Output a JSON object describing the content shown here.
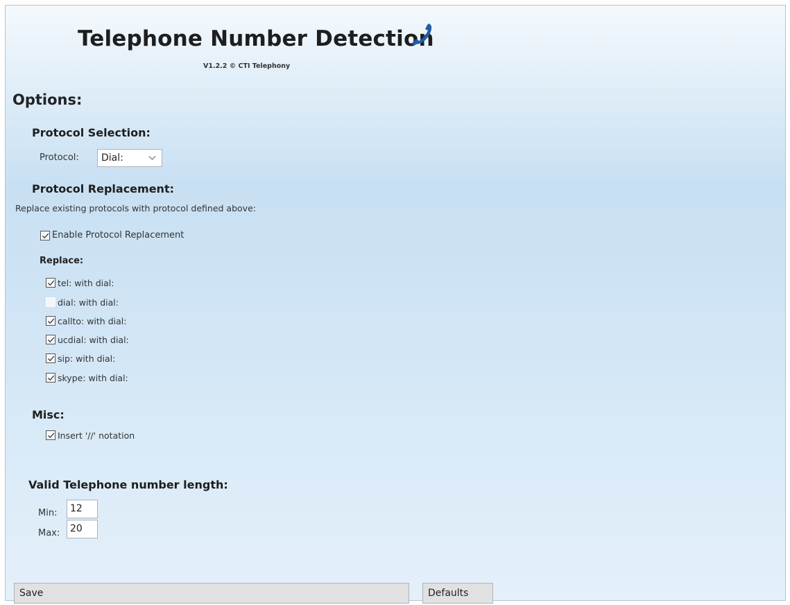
{
  "header": {
    "title": "Telephone Number Detection",
    "version": "V1.2.2 © CTI Telephony",
    "icon": "phone-handset-icon"
  },
  "options": {
    "heading": "Options:"
  },
  "protocol_selection": {
    "heading": "Protocol Selection:",
    "label": "Protocol:",
    "selected": "Dial:"
  },
  "protocol_replacement": {
    "heading": "Protocol Replacement:",
    "description": "Replace existing protocols with protocol defined above:",
    "enable_label": "Enable Protocol Replacement",
    "enable_checked": true,
    "replace_heading": "Replace:",
    "items": [
      {
        "label": "tel: with dial:",
        "checked": true
      },
      {
        "label": "dial: with dial:",
        "checked": false
      },
      {
        "label": "callto: with dial:",
        "checked": true
      },
      {
        "label": "ucdial: with dial:",
        "checked": true
      },
      {
        "label": "sip: with dial:",
        "checked": true
      },
      {
        "label": "skype: with dial:",
        "checked": true
      }
    ]
  },
  "misc": {
    "heading": "Misc:",
    "insert_label": "Insert '//' notation",
    "insert_checked": true
  },
  "length": {
    "heading": "Valid Telephone number length:",
    "min_label": "Min:",
    "min_value": "12",
    "max_label": "Max:",
    "max_value": "20"
  },
  "buttons": {
    "save": "Save",
    "defaults": "Defaults"
  },
  "colors": {
    "accent_icon": "#1f5fa8",
    "background_top": "#f4f9fd",
    "background_mid": "#c8e0f3"
  }
}
